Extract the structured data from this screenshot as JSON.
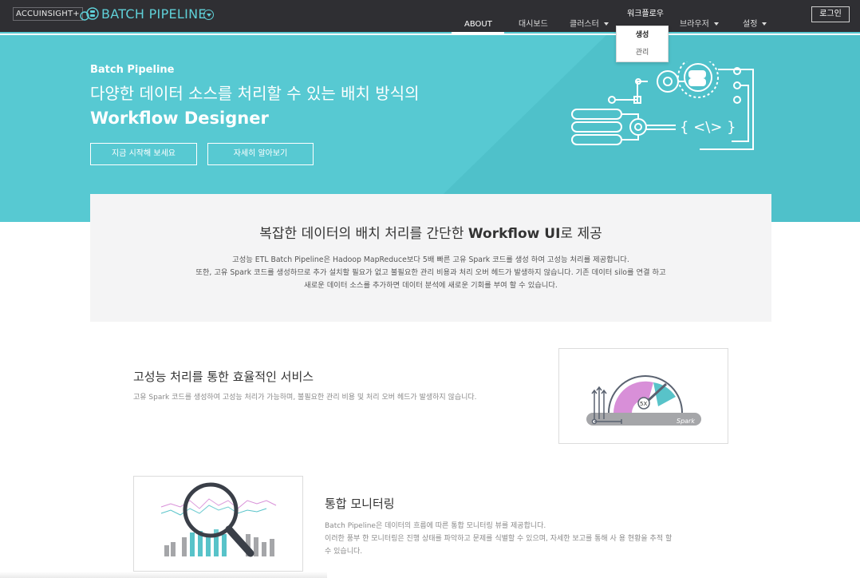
{
  "header": {
    "brand_box": "ACCUINSIGHT+",
    "brand_title": "BATCH PIPELINE",
    "login_label": "로그인",
    "nav": [
      {
        "label": "ABOUT",
        "active": true,
        "has_caret": false
      },
      {
        "label": "대시보드",
        "active": false,
        "has_caret": false
      },
      {
        "label": "클러스터",
        "active": false,
        "has_caret": true
      },
      {
        "label": "워크플로우",
        "active": false,
        "has_caret": false
      },
      {
        "label": "브라우저",
        "active": false,
        "has_caret": true
      },
      {
        "label": "설정",
        "active": false,
        "has_caret": true
      }
    ],
    "dropdown": {
      "items": [
        {
          "label": "생성",
          "selected": true
        },
        {
          "label": "관리",
          "selected": false
        }
      ]
    }
  },
  "hero": {
    "subtitle": "Batch Pipeline",
    "line1": "다양한 데이터 소스를 처리할 수 있는 배치 방식의",
    "line2": "Workflow Designer",
    "buttons": [
      "지금 시작해 보세요",
      "자세히 알아보기"
    ],
    "art_code_label": "{ <\\> }"
  },
  "intro": {
    "title_prefix": "복잡한 데이터의 배치 처리를 간단한 ",
    "title_bold": "Workflow UI",
    "title_suffix": "로 제공",
    "paragraphs": [
      "고성능 ETL Batch Pipeline은 Hadoop MapReduce보다 5배 빠른 고유 Spark 코드를 생성 하여 고성능 처리를 제공합니다.",
      "또한, 고유 Spark 코드를 생성하므로 추가 설치할 필요가 없고 불필요한 관리 비용과 처리 오버 헤드가 발생하지 않습니다. 기존 데이터 silo를 연결 하고",
      "새로운 데이터 소스를 추가하면 데이터 분석에 새로운 기회를 부여 할 수 있습니다."
    ]
  },
  "feature1": {
    "title": "고성능 처리를 통한 효율적인 서비스",
    "desc": "고유 Spark 코드를 생성하여 고성능 처리가 가능하며, 불필요한 관리 비용 및 처리 오버 헤드가 발생하지 않습니다.",
    "gauge_label": "5X",
    "spark_label": "Spark"
  },
  "feature2": {
    "title": "통합 모니터링",
    "paragraphs": [
      "Batch Pipeline은 데이터의 흐름에 따른 통합 모니터링 뷰를 제공합니다.",
      "이러한 풍부 한 모니터링은 진행 상태를 파악하고 문제를 식별할 수 있으며, 자세한 보고를 통해 사 용 현황을 추적 할",
      "수 있습니다."
    ]
  },
  "colors": {
    "topbar": "#2f2f33",
    "accent": "#57c9d2",
    "brand_text": "#5fd0d8"
  }
}
